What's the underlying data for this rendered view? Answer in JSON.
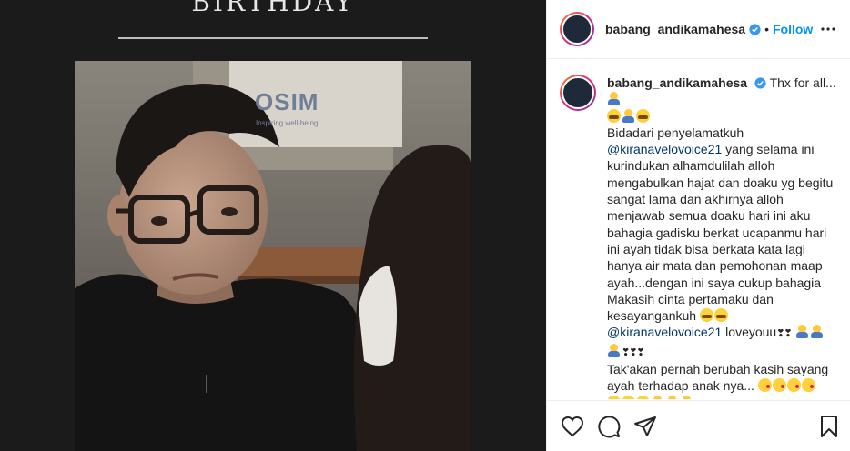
{
  "media": {
    "overlay_title": "BIRTHDAY",
    "sign_brand": "OSIM",
    "sign_tagline": "Inspiring well-being"
  },
  "post": {
    "author": "babang_andikamahesa",
    "follow_label": "Follow",
    "separator": "•"
  },
  "caption": {
    "lead": "Thx for all...",
    "line_bidadari": "Bidadari penyelamatkuh",
    "mention1": "@kiranavelovoice21",
    "body": "yang selama ini kurindukan alhamdulilah alloh mengabulkan hajat dan doaku yg begitu sangat lama dan akhirnya alloh menjawab semua doaku hari ini aku bahagia gadisku berkat ucapanmu hari ini ayah tidak bisa berkata kata lagi hanya air mata dan pemohonan maap ayah...dengan ini saya cukup bahagia Makasih cinta pertamaku dan kesayangankuh",
    "mention2": "@kiranavelovoice21",
    "loveyou": "loveyouu",
    "hearts": "❣❣",
    "hearts2": "❣❣❣",
    "line_takakan": "Tak'akan pernah berubah kasih sayang ayah terhadap anak nya..."
  },
  "icons": {
    "verified": "verified-badge-icon",
    "more": "more-options-icon",
    "like": "heart-icon",
    "comment": "comment-icon",
    "share": "share-icon",
    "save": "bookmark-icon"
  },
  "colors": {
    "follow": "#0095f6",
    "mention": "#00376b",
    "verified": "#3897f0"
  }
}
